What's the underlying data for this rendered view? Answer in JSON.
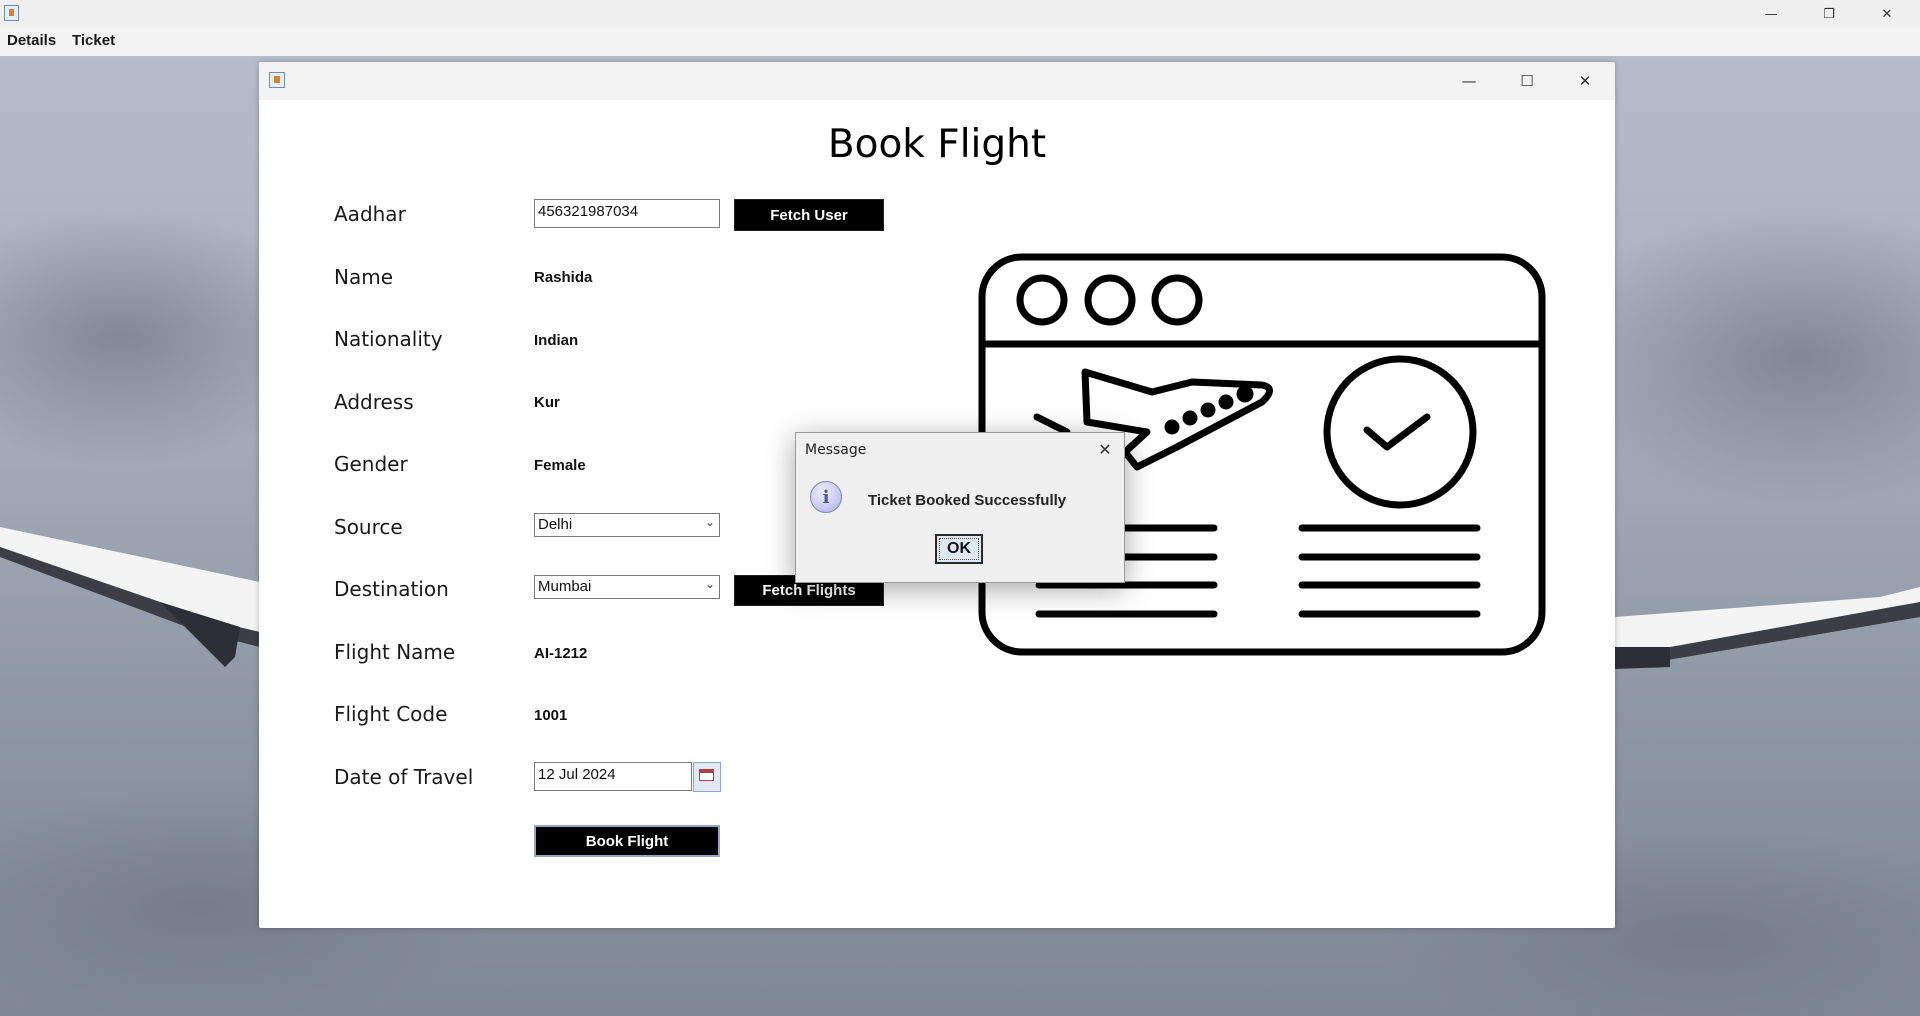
{
  "menubar": {
    "items": [
      "Details",
      "Ticket"
    ]
  },
  "window": {
    "title": "Book Flight"
  },
  "form": {
    "aadhar": {
      "label": "Aadhar",
      "value": "456321987034"
    },
    "fetch_user_label": "Fetch User",
    "name": {
      "label": "Name",
      "value": "Rashida"
    },
    "nationality": {
      "label": "Nationality",
      "value": "Indian"
    },
    "address": {
      "label": "Address",
      "value": "Kur"
    },
    "gender": {
      "label": "Gender",
      "value": "Female"
    },
    "source": {
      "label": "Source",
      "selected": "Delhi"
    },
    "destination": {
      "label": "Destination",
      "selected": "Mumbai"
    },
    "fetch_flights_label": "Fetch Flights",
    "flight_name": {
      "label": "Flight Name",
      "value": "AI-1212"
    },
    "flight_code": {
      "label": "Flight Code",
      "value": "1001"
    },
    "date_of_travel": {
      "label": "Date of Travel",
      "value": "12 Jul 2024"
    },
    "book_flight_label": "Book Flight"
  },
  "dialog": {
    "title": "Message",
    "message": "Ticket Booked Successfully",
    "ok_label": "OK",
    "icon": "info-icon"
  },
  "colors": {
    "button_bg": "#000000",
    "button_text": "#ffffff",
    "ok_button_bg": "#dfe9f6"
  }
}
